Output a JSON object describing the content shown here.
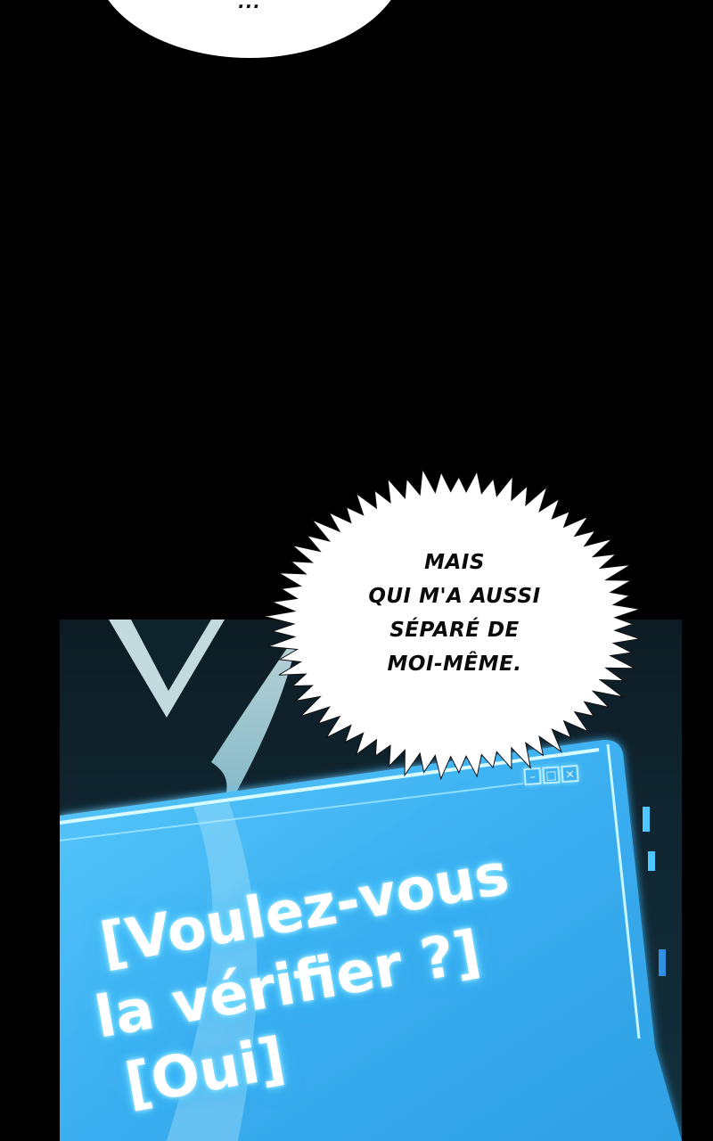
{
  "top_bubble": {
    "text": "..."
  },
  "speech_bubble": {
    "lines": [
      "MAIS",
      "QUI M'A AUSSI",
      "SÉPARÉ DE",
      "MOI-MÊME."
    ]
  },
  "system_window": {
    "lines": [
      "[Voulez-vous",
      "la vérifier ?]",
      "[Oui]"
    ],
    "controls": {
      "minimize": "–",
      "maximize": "□",
      "close": "×"
    }
  },
  "colors": {
    "background": "#000000",
    "window_fill": "#3fb6f3",
    "window_glow": "#7fe7ff",
    "bubble_fill": "#ffffff"
  }
}
